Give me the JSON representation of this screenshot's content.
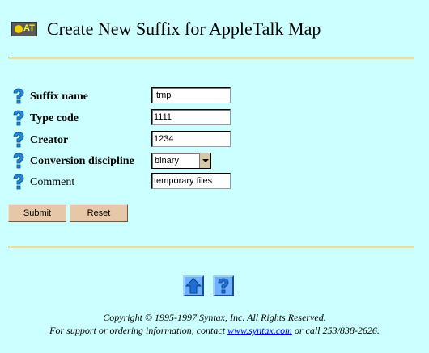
{
  "header": {
    "logo_text": "AT",
    "title": "Create New Suffix for AppleTalk Map"
  },
  "form": {
    "fields": [
      {
        "label": "Suffix name",
        "value": ".tmp"
      },
      {
        "label": "Type code",
        "value": "1111"
      },
      {
        "label": "Creator",
        "value": "1234"
      },
      {
        "label": "Conversion discipline",
        "value": "binary"
      },
      {
        "label": "Comment",
        "value": "temporary files"
      }
    ],
    "submit_label": "Submit",
    "reset_label": "Reset"
  },
  "footer": {
    "copyright": "Copyright © 1995-1997 Syntax, Inc. All Rights Reserved.",
    "support_prefix": "For support or ordering information, contact ",
    "support_link": "www.syntax.com",
    "support_suffix": " or call 253/838-2626."
  },
  "colors": {
    "background": "#ccffff",
    "button": "#e6c8a8",
    "help_icon": "#1e8ad6",
    "nav_icon": "#6db0ff",
    "link": "#0000ee"
  }
}
